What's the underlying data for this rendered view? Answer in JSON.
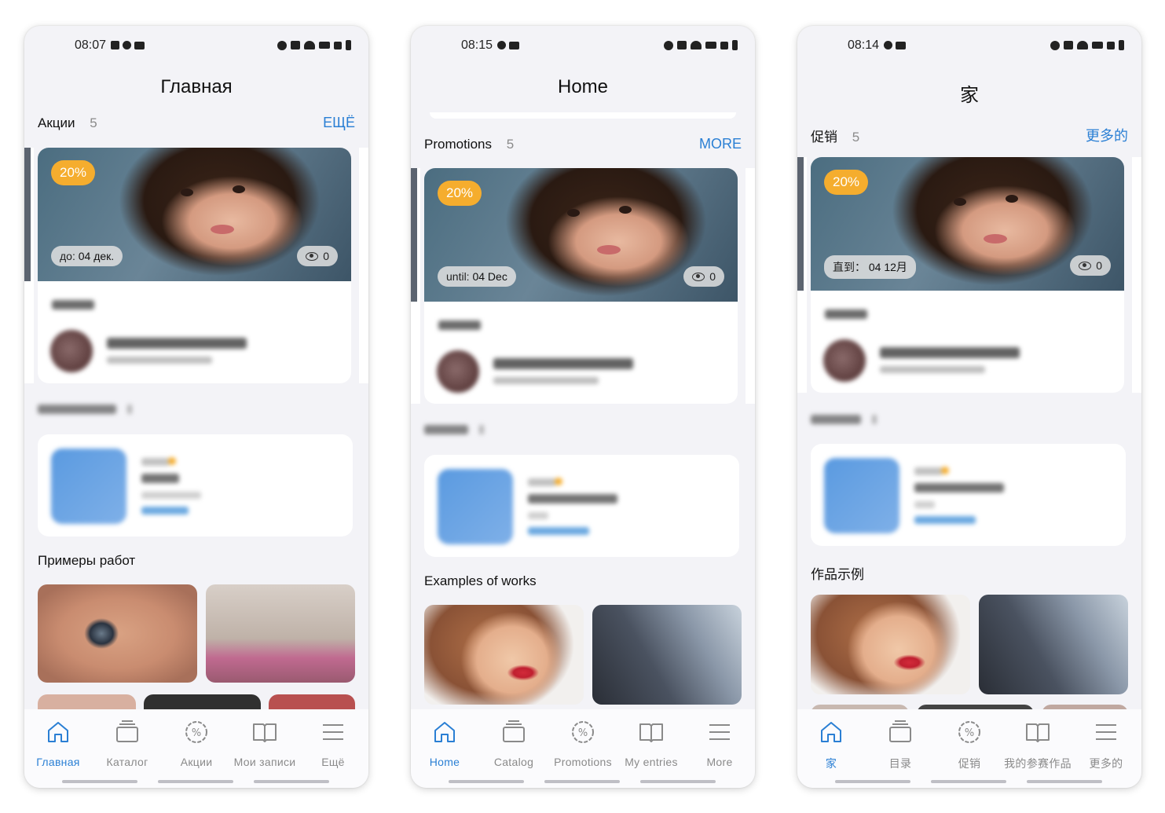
{
  "colors": {
    "accent": "#2a7fd4",
    "badge": "#f5ad2e",
    "background": "#f3f3f7"
  },
  "screens": [
    {
      "status_time": "08:07",
      "title": "Главная",
      "promotions": {
        "label": "Акции",
        "count": "5",
        "more": "ЕЩЁ"
      },
      "promo_card": {
        "discount": "20%",
        "until_prefix": "до:",
        "until_date": "04 дек.",
        "views": "0"
      },
      "works_title": "Примеры работ",
      "nav": [
        "Главная",
        "Каталог",
        "Акции",
        "Мои записи",
        "Ещё"
      ],
      "nav_icons": [
        "home-icon",
        "catalog-icon",
        "discount-icon",
        "book-icon",
        "menu-icon"
      ],
      "active_nav": 0
    },
    {
      "status_time": "08:15",
      "title": "Home",
      "promotions": {
        "label": "Promotions",
        "count": "5",
        "more": "MORE"
      },
      "promo_card": {
        "discount": "20%",
        "until_prefix": "until:",
        "until_date": "04 Dec",
        "views": "0"
      },
      "works_title": "Examples of works",
      "nav": [
        "Home",
        "Catalog",
        "Promotions",
        "My entries",
        "More"
      ],
      "nav_icons": [
        "home-icon",
        "catalog-icon",
        "discount-icon",
        "book-icon",
        "menu-icon"
      ],
      "active_nav": 0
    },
    {
      "status_time": "08:14",
      "title": "家",
      "promotions": {
        "label": "促销",
        "count": "5",
        "more": "更多的"
      },
      "promo_card": {
        "discount": "20%",
        "until_prefix": "直到：",
        "until_date": "04 12月",
        "views": "0"
      },
      "works_title": "作品示例",
      "nav": [
        "家",
        "目录",
        "促销",
        "我的参赛作品",
        "更多的"
      ],
      "nav_icons": [
        "home-icon",
        "catalog-icon",
        "discount-icon",
        "book-icon",
        "menu-icon"
      ],
      "active_nav": 0
    }
  ]
}
